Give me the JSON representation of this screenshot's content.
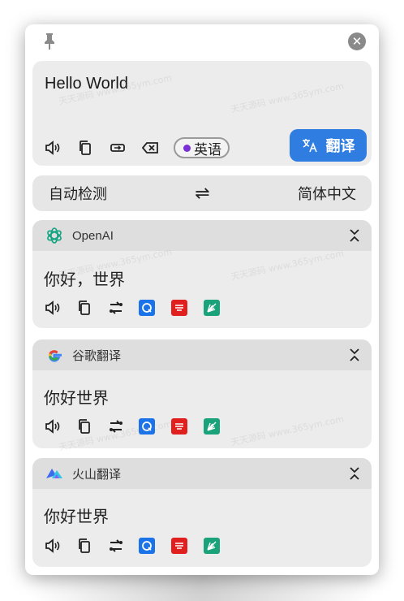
{
  "input": {
    "text": "Hello World"
  },
  "source_lang_pill": "英语",
  "translate_button": "翻译",
  "lang_bar": {
    "from": "自动检测",
    "swap_symbol": "⇌",
    "to": "简体中文"
  },
  "results": [
    {
      "service": "OpenAI",
      "text": "你好，世界"
    },
    {
      "service": "谷歌翻译",
      "text": "你好世界"
    },
    {
      "service": "火山翻译",
      "text": "你好世界"
    }
  ],
  "close_symbol": "✕",
  "watermark": "天天源码 www.365ym.com",
  "colors": {
    "accent": "#2f7de1",
    "lang_dot": "#7b2fd6",
    "openai": "#10a37f",
    "youdao": "#e01f1f",
    "bing_like": "#1aa37a",
    "dict_blue": "#1a73e8"
  }
}
